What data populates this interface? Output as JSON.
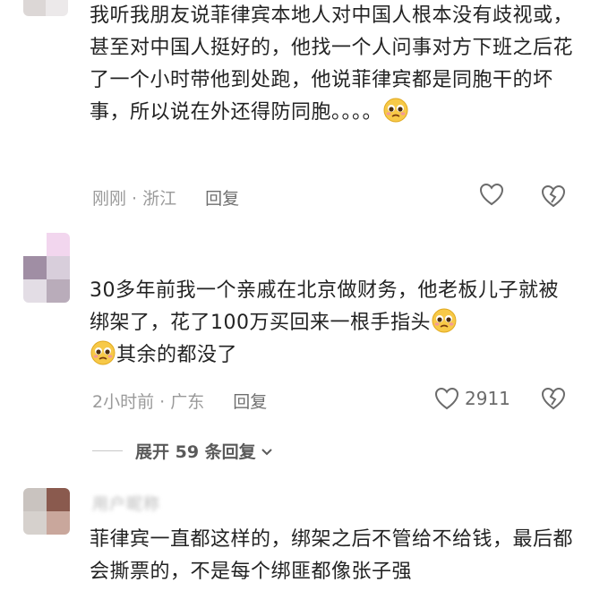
{
  "comments": [
    {
      "text": "我听我朋友说菲律宾本地人对中国人根本没有歧视或，甚至对中国人挺好的，他找一个人问事对方下班之后花了一个小时带他到处跑，他说菲律宾都是同胞干的坏事，所以说在外还得防同胞。。。。",
      "meta": "刚刚 · 浙江",
      "reply": "回复",
      "likes": "",
      "emoji": "pleading-face"
    },
    {
      "text_before": "30多年前我一个亲戚在北京做财务，他老板儿子就被绑架了，花了100万买回来一根手指头",
      "text_after": "其余的都没了",
      "meta": "2小时前 · 广东",
      "reply": "回复",
      "likes": "2911",
      "emoji": "pleading-face"
    },
    {
      "text": "菲律宾一直都这样的，绑架之后不管给不给钱，最后都会撕票的，不是每个绑匪都像张子强",
      "username_blurred": "用户昵称"
    }
  ],
  "expand": {
    "label": "展开 59 条回复",
    "icon": "chevron-down-icon"
  },
  "colors": {
    "text": "#232323",
    "meta": "#9a9a9a",
    "icon": "#6b6b6b"
  }
}
